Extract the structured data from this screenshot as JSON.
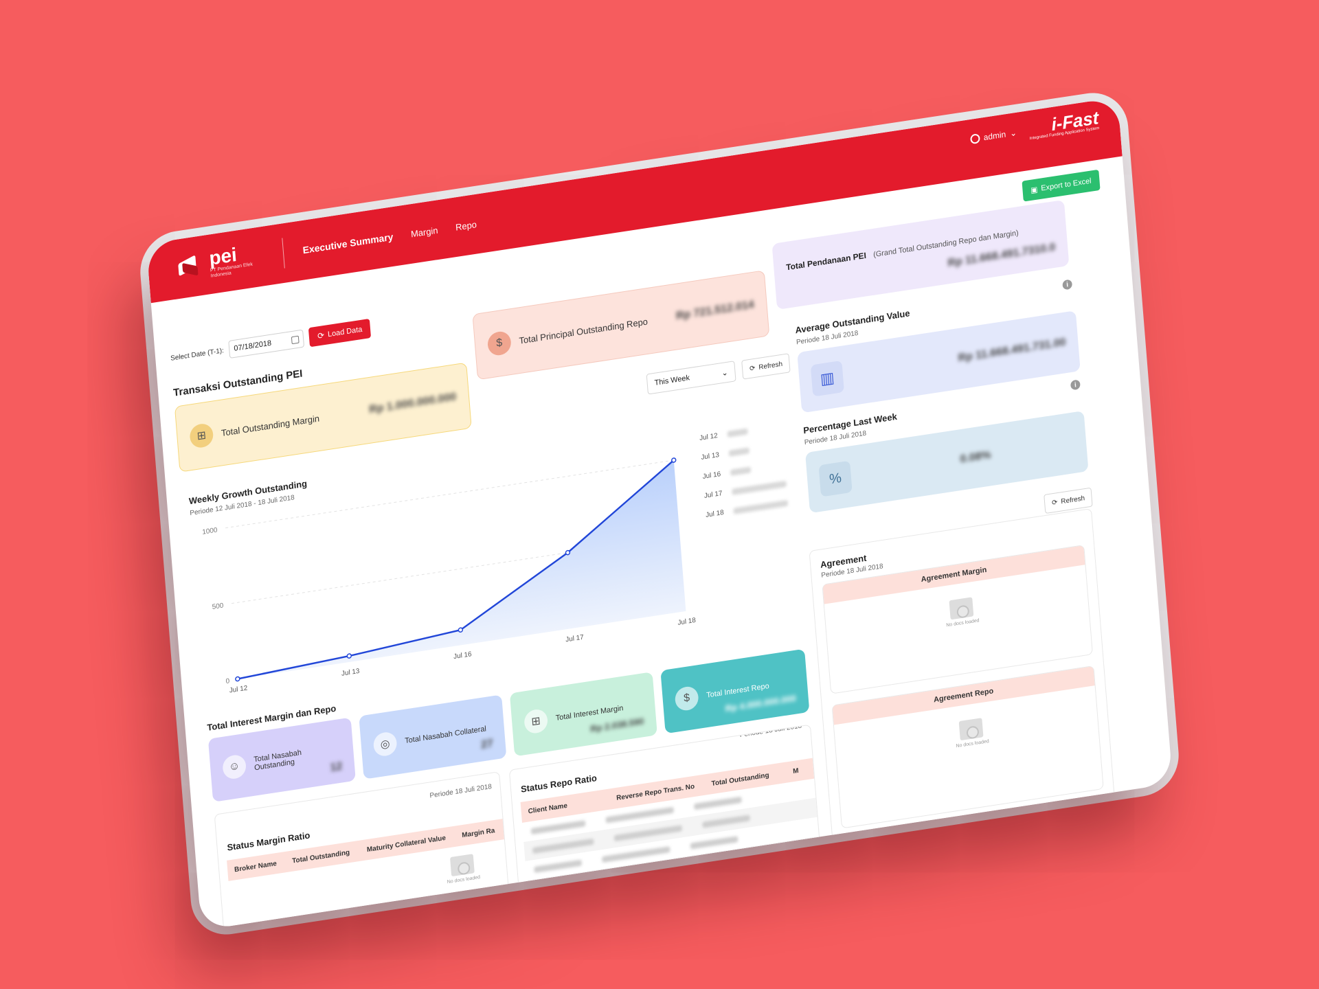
{
  "header": {
    "logo_text": "pei",
    "logo_subtitle": "PT Pendanaan Efek Indonesia",
    "nav": [
      "Executive Summary",
      "Margin",
      "Repo"
    ],
    "user": "admin",
    "brand_title": "i-Fast",
    "brand_subtitle": "Integrated Funding Application System"
  },
  "toolbar": {
    "export_label": "Export to Excel",
    "date_label": "Select Date (T-1):",
    "date_value": "07/18/2018",
    "load_label": "Load Data"
  },
  "outstanding": {
    "title": "Transaksi Outstanding PEI",
    "margin_label": "Total Outstanding Margin",
    "margin_value": "Rp 1.000.000.000",
    "repo_label": "Total Principal Outstanding Repo",
    "repo_value": "Rp 721.512.014",
    "pendanaan_label": "Total Pendanaan PEI",
    "pendanaan_note": "(Grand Total Outstanding Repo dan Margin)",
    "pendanaan_value": "Rp 11.668.491.7310.0"
  },
  "growth": {
    "title": "Weekly Growth Outstanding",
    "period": "Periode 12 Juli 2018 - 18 Juli 2018",
    "range_select": "This Week",
    "refresh_label": "Refresh",
    "legend": [
      "Jul 12",
      "Jul 13",
      "Jul 16",
      "Jul 17",
      "Jul 18"
    ]
  },
  "chart_data": {
    "type": "area",
    "categories": [
      "Jul 12",
      "Jul 13",
      "Jul 16",
      "Jul 17",
      "Jul 18"
    ],
    "values": [
      0,
      40,
      100,
      500,
      1000
    ],
    "ylim": [
      0,
      1000
    ],
    "y_ticks": [
      "0",
      "500",
      "1000"
    ],
    "color": "#2146d8",
    "grid": true
  },
  "average": {
    "title": "Average Outstanding Value",
    "period": "Periode 18 Juli 2018",
    "value": "Rp 11.668.491.731.00"
  },
  "percentage": {
    "title": "Percentage Last Week",
    "period": "Periode 18 Juli 2018",
    "value": "0.08%"
  },
  "interest": {
    "title": "Total Interest Margin dan Repo",
    "nasabah_outstanding": "Total Nasabah Outstanding",
    "nasabah_outstanding_value": "12",
    "nasabah_collateral": "Total Nasabah Collateral",
    "nasabah_collateral_value": "27",
    "interest_margin": "Total Interest Margin",
    "interest_margin_value": "Rp 2.038.590",
    "interest_repo": "Total Interest Repo",
    "interest_repo_value": "Rp 4.000.000.000"
  },
  "margin_ratio": {
    "title": "Status Margin Ratio",
    "period": "Periode 18 Juli 2018",
    "columns": [
      "Broker Name",
      "Total Outstanding",
      "Maturity Collateral Value",
      "Margin Ra"
    ],
    "empty_text": "No docs loaded"
  },
  "repo_ratio": {
    "title": "Status Repo Ratio",
    "period": "Periode 18 Juli 2018",
    "columns": [
      "Client Name",
      "Reverse Repo Trans. No",
      "Total Outstanding",
      "M"
    ]
  },
  "agreement": {
    "title": "Agreement",
    "period": "Periode 18 Juli 2018",
    "refresh_label": "Refresh",
    "margin_label": "Agreement Margin",
    "repo_label": "Agreement Repo",
    "empty_text": "No docs loaded"
  },
  "colors": {
    "brand_red": "#e31b2c",
    "export_green": "#2bbf6f",
    "margin_card": "#fdf0d0",
    "repo_card": "#fde3dc",
    "pendanaan_card": "#efe8fb",
    "average_card": "#e3e8fb",
    "percentage_card": "#dae9f3",
    "nasabah_outstanding_card": "#d6d0fa",
    "nasabah_collateral_card": "#c8d9fb",
    "interest_margin_card": "#c8f0dc",
    "interest_repo_card": "#4fc2c5"
  }
}
